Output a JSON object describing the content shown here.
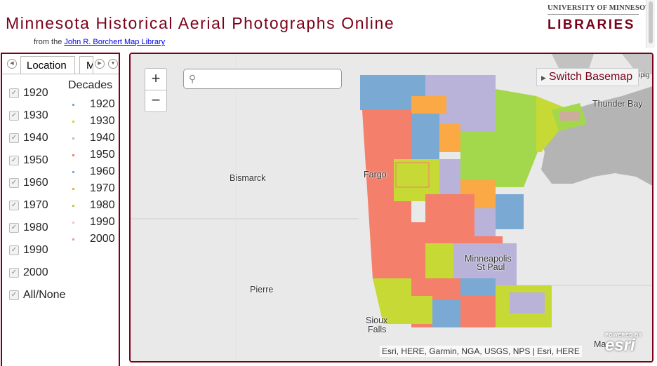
{
  "header": {
    "title": "Minnesota Historical Aerial Photographs Online",
    "subtitle_prefix": "from the",
    "subtitle_link": "John R. Borchert Map Library",
    "logo_top": "UNIVERSITY OF MINNESOTA",
    "logo_bottom": "LIBRARIES"
  },
  "panel": {
    "tabs": [
      "Location",
      "M"
    ],
    "decades_checks": [
      "1920",
      "1930",
      "1940",
      "1950",
      "1960",
      "1970",
      "1980",
      "1990",
      "2000"
    ],
    "all_none_label": "All/None",
    "legend_title": "Decades",
    "legend": [
      {
        "label": "1920",
        "color": "#7aa9d4"
      },
      {
        "label": "1930",
        "color": "#c6d935"
      },
      {
        "label": "1940",
        "color": "#b9b3d9"
      },
      {
        "label": "1950",
        "color": "#f47f6b"
      },
      {
        "label": "1960",
        "color": "#7aa9d4"
      },
      {
        "label": "1970",
        "color": "#fba944"
      },
      {
        "label": "1980",
        "color": "#a3d84c"
      },
      {
        "label": "1990",
        "color": "#f6c2d0"
      },
      {
        "label": "2000",
        "color": "#e98dd5"
      }
    ]
  },
  "map": {
    "zoom_in": "+",
    "zoom_out": "−",
    "search_placeholder": "",
    "basemap_button": "Switch Basemap",
    "cities": {
      "bismarck": "Bismarck",
      "fargo": "Fargo",
      "pierre": "Pierre",
      "minneapolis": "Minneapolis",
      "st_paul": "St Paul",
      "sioux_falls_1": "Sioux",
      "sioux_falls_2": "Falls",
      "thunder_bay": "Thunder Bay",
      "nipigon": "ipig",
      "madison": "Ma"
    },
    "attribution": "Esri, HERE, Garmin, NGA, USGS, NPS | Esri, HERE",
    "esri_powered": "POWERED BY",
    "esri_name": "esri"
  }
}
